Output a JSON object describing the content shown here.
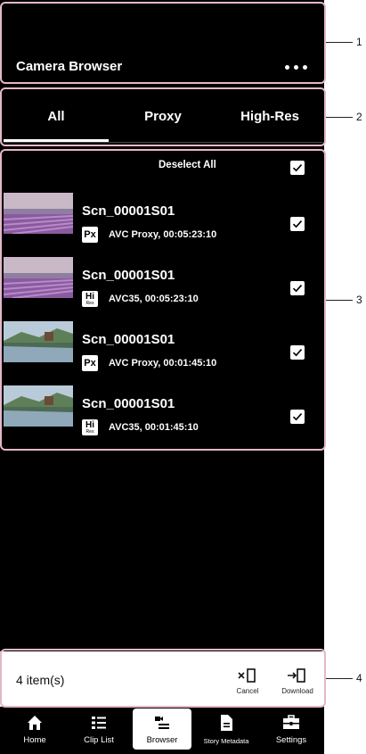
{
  "header": {
    "title": "Camera Browser",
    "more_icon": "more-horizontal-icon"
  },
  "tabs": [
    {
      "label": "All",
      "active": true
    },
    {
      "label": "Proxy",
      "active": false
    },
    {
      "label": "High-Res",
      "active": false
    }
  ],
  "list": {
    "deselect_label": "Deselect All",
    "select_all_checked": true,
    "clips": [
      {
        "name": "Scn_00001S01",
        "badge": "Px",
        "badge_sub": "",
        "meta": "AVC Proxy, 00:05:23:10",
        "thumb": "lavender-field",
        "checked": true
      },
      {
        "name": "Scn_00001S01",
        "badge": "Hi",
        "badge_sub": "Res",
        "meta": "AVC35, 00:05:23:10",
        "thumb": "lavender-field",
        "checked": true
      },
      {
        "name": "Scn_00001S01",
        "badge": "Px",
        "badge_sub": "",
        "meta": "AVC Proxy, 00:01:45:10",
        "thumb": "lake-house",
        "checked": true
      },
      {
        "name": "Scn_00001S01",
        "badge": "Hi",
        "badge_sub": "Res",
        "meta": "AVC35, 00:01:45:10",
        "thumb": "lake-house",
        "checked": true
      }
    ]
  },
  "action_bar": {
    "count_label": "4 item(s)",
    "cancel_label": "Cancel",
    "download_label": "Download"
  },
  "bottom_nav": [
    {
      "label": "Home",
      "icon": "home-icon",
      "active": false
    },
    {
      "label": "Clip List",
      "icon": "clip-list-icon",
      "active": false
    },
    {
      "label": "Browser",
      "icon": "browser-icon",
      "active": true
    },
    {
      "label": "Story Metadata",
      "icon": "story-metadata-icon",
      "active": false
    },
    {
      "label": "Settings",
      "icon": "settings-icon",
      "active": false
    }
  ],
  "callouts": [
    "1",
    "2",
    "3",
    "4"
  ],
  "colors": {
    "background": "#000000",
    "annotation": "#e4b6c8",
    "text": "#ffffff"
  }
}
